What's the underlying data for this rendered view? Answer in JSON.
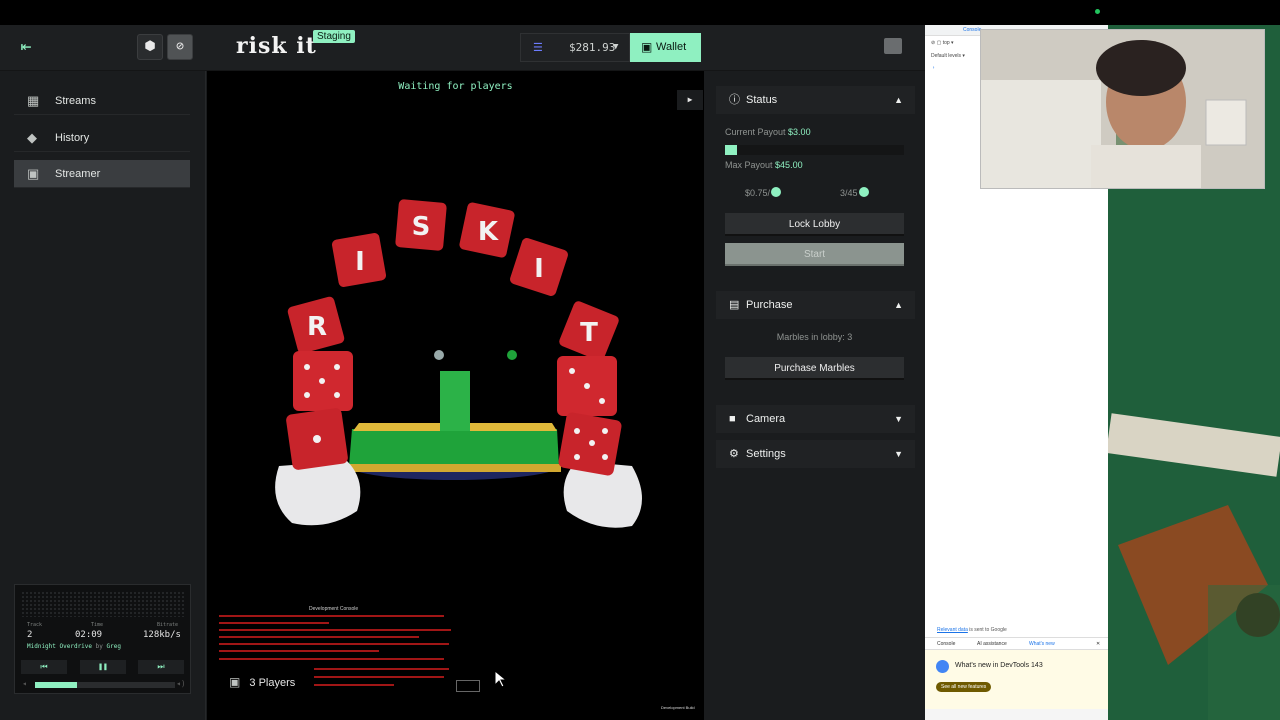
{
  "header": {
    "logo_text": "risk it",
    "environment_badge": "Staging",
    "balance": "$281.93",
    "wallet_label": "Wallet"
  },
  "sidebar": {
    "items": [
      {
        "label": "Streams",
        "icon": "streams-icon"
      },
      {
        "label": "History",
        "icon": "history-icon"
      },
      {
        "label": "Streamer",
        "icon": "streamer-icon",
        "active": true
      }
    ]
  },
  "music_player": {
    "track_label": "Track",
    "track_value": "2",
    "time_label": "Time",
    "time_value": "02:09",
    "bitrate_label": "Bitrate",
    "bitrate_value": "128kb/s",
    "song": "Midnight Overdrive",
    "by_word": "by",
    "artist": "Greg",
    "volume_fraction": 0.3
  },
  "game": {
    "status": "Waiting for players",
    "banner_letters": [
      "R",
      "I",
      "S",
      "K",
      "I",
      "T"
    ],
    "dev_console_title": "Development Console",
    "players": "3 Players",
    "dev_build": "Development Build"
  },
  "status_panel": {
    "title": "Status",
    "current_payout_label": "Current Payout",
    "current_payout": "$3.00",
    "payout_progress": 0.0667,
    "max_payout_label": "Max Payout",
    "max_payout": "$45.00",
    "chip_1": "$0.75/",
    "chip_2": "3/45",
    "lock_button": "Lock Lobby",
    "start_button": "Start"
  },
  "purchase_panel": {
    "title": "Purchase",
    "marbles_text": "Marbles in lobby: 3",
    "purchase_button": "Purchase Marbles"
  },
  "camera_panel": {
    "title": "Camera"
  },
  "settings_panel": {
    "title": "Settings"
  },
  "devtools": {
    "tab": "Console",
    "context": "top",
    "levels": "Default levels",
    "relevant_link": "Relevant data",
    "relevant_rest": "is sent to Google",
    "drawer_tabs": [
      "Console",
      "AI assistance",
      "What's new"
    ],
    "whats_new_title": "What's new in DevTools 143",
    "see_features": "See all new features"
  },
  "colors": {
    "accent": "#8ff0c1",
    "panel": "#1a1c1e",
    "devtools_bg": "#ffffff"
  }
}
